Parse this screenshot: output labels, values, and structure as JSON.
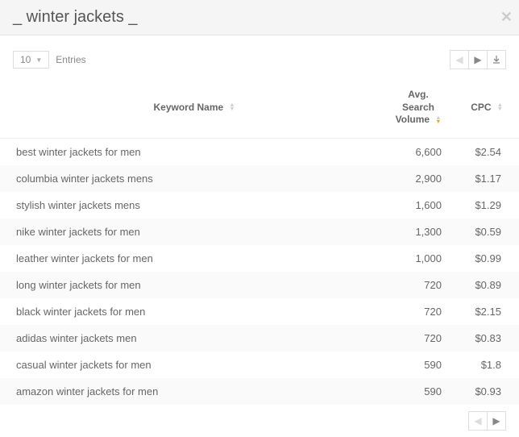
{
  "header": {
    "title": "_ winter jackets _"
  },
  "controls": {
    "page_size": "10",
    "entries_label": "Entries"
  },
  "table": {
    "columns": {
      "keyword": "Keyword Name",
      "volume_l1": "Avg.",
      "volume_l2": "Search",
      "volume_l3": "Volume",
      "cpc": "CPC"
    },
    "rows": [
      {
        "keyword": "best winter jackets for men",
        "volume": "6,600",
        "cpc": "$2.54"
      },
      {
        "keyword": "columbia winter jackets mens",
        "volume": "2,900",
        "cpc": "$1.17"
      },
      {
        "keyword": "stylish winter jackets mens",
        "volume": "1,600",
        "cpc": "$1.29"
      },
      {
        "keyword": "nike winter jackets for men",
        "volume": "1,300",
        "cpc": "$0.59"
      },
      {
        "keyword": "leather winter jackets for men",
        "volume": "1,000",
        "cpc": "$0.99"
      },
      {
        "keyword": "long winter jackets for men",
        "volume": "720",
        "cpc": "$0.89"
      },
      {
        "keyword": "black winter jackets for men",
        "volume": "720",
        "cpc": "$2.15"
      },
      {
        "keyword": "adidas winter jackets men",
        "volume": "720",
        "cpc": "$0.83"
      },
      {
        "keyword": "casual winter jackets for men",
        "volume": "590",
        "cpc": "$1.8"
      },
      {
        "keyword": "amazon winter jackets for men",
        "volume": "590",
        "cpc": "$0.93"
      }
    ]
  }
}
